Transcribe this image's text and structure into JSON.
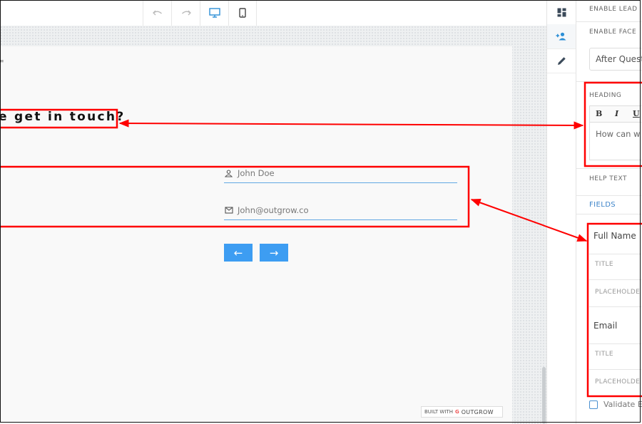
{
  "canvas": {
    "quote_mark": "\"",
    "heading": "e get in touch?",
    "fields": [
      {
        "icon": "person-icon",
        "placeholder": "John Doe"
      },
      {
        "icon": "envelope-icon",
        "placeholder": "John@outgrow.co"
      }
    ],
    "prev_label": "←",
    "next_label": "→",
    "built_with": {
      "prefix": "BUILT WITH",
      "brand": "OUTGROW"
    }
  },
  "toolbar": {
    "buttons": [
      "undo-icon",
      "redo-icon",
      "desktop-icon",
      "mobile-icon"
    ]
  },
  "strip": {
    "buttons": [
      "dashboard-icon",
      "add-user-icon",
      "pencil-icon"
    ]
  },
  "panel": {
    "enable_lead": "ENABLE LEAD",
    "enable_face": "ENABLE FACE",
    "select_value": "After Questi",
    "heading_label": "HEADING",
    "editor_buttons": {
      "bold": "B",
      "italic": "I",
      "underline": "U"
    },
    "editor_text": "How can w",
    "help_text": "HELP TEXT",
    "fields_tab": "FIELDS",
    "field_items": [
      {
        "name": "Full Name",
        "title": "TITLE",
        "placeholder": "PLACEHOLDE"
      },
      {
        "name": "Email",
        "title": "TITLE",
        "placeholder": "PLACEHOLDE"
      }
    ],
    "validate_label": "Validate E"
  },
  "colors": {
    "accent": "#3d9df2",
    "annotation": "#ff0000",
    "field_underline": "#62a8e3"
  }
}
